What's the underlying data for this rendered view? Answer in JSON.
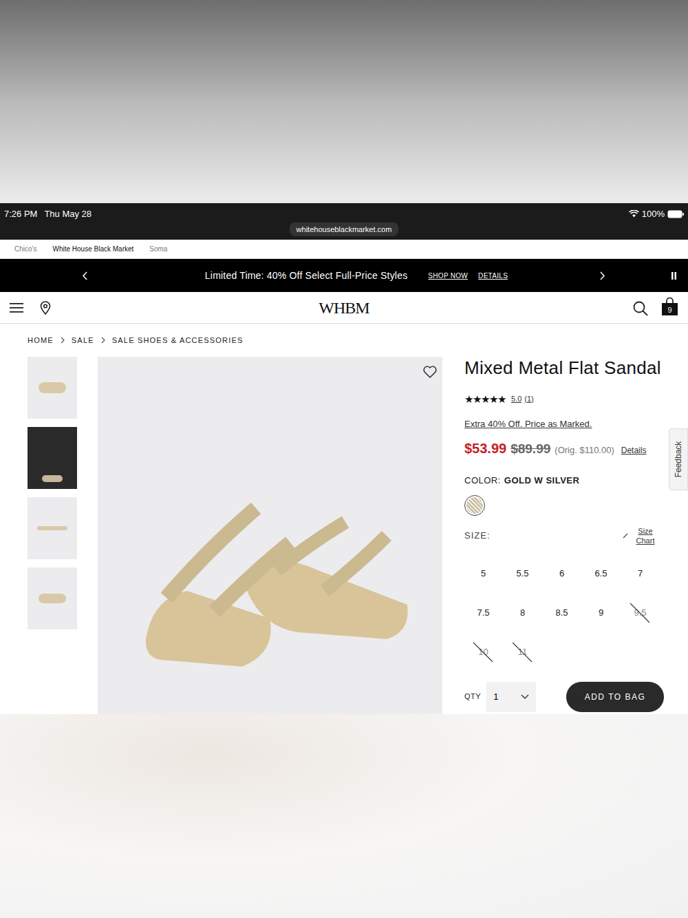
{
  "status_bar": {
    "time": "7:26 PM",
    "date": "Thu May 28",
    "battery": "100%",
    "url": "whitehouseblackmarket.com"
  },
  "brand_tabs": [
    {
      "label": "Chico's",
      "selected": false
    },
    {
      "label": "White House Black Market",
      "selected": true
    },
    {
      "label": "Soma",
      "selected": false
    }
  ],
  "promo": {
    "text": "Limited Time: 40% Off Select Full-Price Styles",
    "links": [
      "SHOP NOW",
      "DETAILS"
    ]
  },
  "header": {
    "logo": "WHBM",
    "bag_count": "9"
  },
  "breadcrumb": [
    "HOME",
    "SALE",
    "SALE SHOES & ACCESSORIES"
  ],
  "product": {
    "title": "Mixed Metal Flat Sandal",
    "stars": 5,
    "rating": "5.0",
    "review_count": "(1)",
    "promo": "Extra 40% Off. Price as Marked.",
    "sale_price": "$53.99",
    "price": "$89.99",
    "orig_price": "(Orig. $110.00)",
    "details": "Details",
    "color_label": "COLOR:",
    "color_value": "GOLD W SILVER",
    "size_label": "SIZE:",
    "size_chart": "Size Chart",
    "sizes": [
      {
        "label": "5",
        "disabled": false
      },
      {
        "label": "5.5",
        "disabled": false
      },
      {
        "label": "6",
        "disabled": false
      },
      {
        "label": "6.5",
        "disabled": false
      },
      {
        "label": "7",
        "disabled": false
      },
      {
        "label": "7.5",
        "disabled": false
      },
      {
        "label": "8",
        "disabled": false
      },
      {
        "label": "8.5",
        "disabled": false
      },
      {
        "label": "9",
        "disabled": false
      },
      {
        "label": "9.5",
        "disabled": true
      },
      {
        "label": "10",
        "disabled": true
      },
      {
        "label": "11",
        "disabled": true
      }
    ],
    "qty_label": "QTY",
    "qty": "1",
    "add_to_bag": "ADD TO BAG"
  },
  "feedback": "Feedback"
}
